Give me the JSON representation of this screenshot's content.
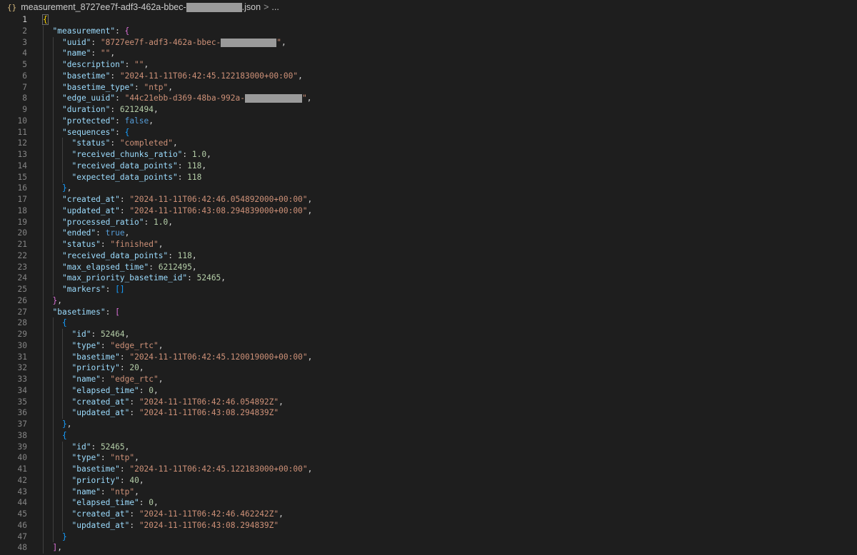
{
  "breadcrumb": {
    "icon": "{}",
    "file_prefix": "measurement_8727ee7f-adf3-462a-bbec-",
    "file_suffix": ".json",
    "separator": ">",
    "ellipsis": "..."
  },
  "colors": {
    "background": "#1e1e1e",
    "key": "#9cdcfe",
    "string": "#ce9178",
    "number": "#b5cea8",
    "keyword": "#569cd6",
    "line_number": "#858585"
  },
  "lines": [
    {
      "n": "1",
      "indent": 0,
      "t": [
        [
          "b1",
          "{"
        ]
      ]
    },
    {
      "n": "2",
      "indent": 1,
      "t": [
        [
          "key",
          "\"measurement\""
        ],
        [
          "punc",
          ": "
        ],
        [
          "b2",
          "{"
        ]
      ]
    },
    {
      "n": "3",
      "indent": 2,
      "t": [
        [
          "key",
          "\"uuid\""
        ],
        [
          "punc",
          ": "
        ],
        [
          "str",
          "\"8727ee7f-adf3-462a-bbec-"
        ],
        [
          "redact",
          ""
        ],
        [
          "str",
          "\""
        ],
        [
          "punc",
          ","
        ]
      ]
    },
    {
      "n": "4",
      "indent": 2,
      "t": [
        [
          "key",
          "\"name\""
        ],
        [
          "punc",
          ": "
        ],
        [
          "str",
          "\"\""
        ],
        [
          "punc",
          ","
        ]
      ]
    },
    {
      "n": "5",
      "indent": 2,
      "t": [
        [
          "key",
          "\"description\""
        ],
        [
          "punc",
          ": "
        ],
        [
          "str",
          "\"\""
        ],
        [
          "punc",
          ","
        ]
      ]
    },
    {
      "n": "6",
      "indent": 2,
      "t": [
        [
          "key",
          "\"basetime\""
        ],
        [
          "punc",
          ": "
        ],
        [
          "str",
          "\"2024-11-11T06:42:45.122183000+00:00\""
        ],
        [
          "punc",
          ","
        ]
      ]
    },
    {
      "n": "7",
      "indent": 2,
      "t": [
        [
          "key",
          "\"basetime_type\""
        ],
        [
          "punc",
          ": "
        ],
        [
          "str",
          "\"ntp\""
        ],
        [
          "punc",
          ","
        ]
      ]
    },
    {
      "n": "8",
      "indent": 2,
      "t": [
        [
          "key",
          "\"edge_uuid\""
        ],
        [
          "punc",
          ": "
        ],
        [
          "str",
          "\"44c21ebb-d369-48ba-992a-"
        ],
        [
          "redact",
          ""
        ],
        [
          "str",
          "\""
        ],
        [
          "punc",
          ","
        ]
      ]
    },
    {
      "n": "9",
      "indent": 2,
      "t": [
        [
          "key",
          "\"duration\""
        ],
        [
          "punc",
          ": "
        ],
        [
          "num",
          "6212494"
        ],
        [
          "punc",
          ","
        ]
      ]
    },
    {
      "n": "10",
      "indent": 2,
      "t": [
        [
          "key",
          "\"protected\""
        ],
        [
          "punc",
          ": "
        ],
        [
          "kw",
          "false"
        ],
        [
          "punc",
          ","
        ]
      ]
    },
    {
      "n": "11",
      "indent": 2,
      "t": [
        [
          "key",
          "\"sequences\""
        ],
        [
          "punc",
          ": "
        ],
        [
          "b3",
          "{"
        ]
      ]
    },
    {
      "n": "12",
      "indent": 3,
      "t": [
        [
          "key",
          "\"status\""
        ],
        [
          "punc",
          ": "
        ],
        [
          "str",
          "\"completed\""
        ],
        [
          "punc",
          ","
        ]
      ]
    },
    {
      "n": "13",
      "indent": 3,
      "t": [
        [
          "key",
          "\"received_chunks_ratio\""
        ],
        [
          "punc",
          ": "
        ],
        [
          "num",
          "1.0"
        ],
        [
          "punc",
          ","
        ]
      ]
    },
    {
      "n": "14",
      "indent": 3,
      "t": [
        [
          "key",
          "\"received_data_points\""
        ],
        [
          "punc",
          ": "
        ],
        [
          "num",
          "118"
        ],
        [
          "punc",
          ","
        ]
      ]
    },
    {
      "n": "15",
      "indent": 3,
      "t": [
        [
          "key",
          "\"expected_data_points\""
        ],
        [
          "punc",
          ": "
        ],
        [
          "num",
          "118"
        ]
      ]
    },
    {
      "n": "16",
      "indent": 2,
      "t": [
        [
          "b3",
          "}"
        ],
        [
          "punc",
          ","
        ]
      ]
    },
    {
      "n": "17",
      "indent": 2,
      "t": [
        [
          "key",
          "\"created_at\""
        ],
        [
          "punc",
          ": "
        ],
        [
          "str",
          "\"2024-11-11T06:42:46.054892000+00:00\""
        ],
        [
          "punc",
          ","
        ]
      ]
    },
    {
      "n": "18",
      "indent": 2,
      "t": [
        [
          "key",
          "\"updated_at\""
        ],
        [
          "punc",
          ": "
        ],
        [
          "str",
          "\"2024-11-11T06:43:08.294839000+00:00\""
        ],
        [
          "punc",
          ","
        ]
      ]
    },
    {
      "n": "19",
      "indent": 2,
      "t": [
        [
          "key",
          "\"processed_ratio\""
        ],
        [
          "punc",
          ": "
        ],
        [
          "num",
          "1.0"
        ],
        [
          "punc",
          ","
        ]
      ]
    },
    {
      "n": "20",
      "indent": 2,
      "t": [
        [
          "key",
          "\"ended\""
        ],
        [
          "punc",
          ": "
        ],
        [
          "kw",
          "true"
        ],
        [
          "punc",
          ","
        ]
      ]
    },
    {
      "n": "21",
      "indent": 2,
      "t": [
        [
          "key",
          "\"status\""
        ],
        [
          "punc",
          ": "
        ],
        [
          "str",
          "\"finished\""
        ],
        [
          "punc",
          ","
        ]
      ]
    },
    {
      "n": "22",
      "indent": 2,
      "t": [
        [
          "key",
          "\"received_data_points\""
        ],
        [
          "punc",
          ": "
        ],
        [
          "num",
          "118"
        ],
        [
          "punc",
          ","
        ]
      ]
    },
    {
      "n": "23",
      "indent": 2,
      "t": [
        [
          "key",
          "\"max_elapsed_time\""
        ],
        [
          "punc",
          ": "
        ],
        [
          "num",
          "6212495"
        ],
        [
          "punc",
          ","
        ]
      ]
    },
    {
      "n": "24",
      "indent": 2,
      "t": [
        [
          "key",
          "\"max_priority_basetime_id\""
        ],
        [
          "punc",
          ": "
        ],
        [
          "num",
          "52465"
        ],
        [
          "punc",
          ","
        ]
      ]
    },
    {
      "n": "25",
      "indent": 2,
      "t": [
        [
          "key",
          "\"markers\""
        ],
        [
          "punc",
          ": "
        ],
        [
          "b3",
          "[]"
        ]
      ]
    },
    {
      "n": "26",
      "indent": 1,
      "t": [
        [
          "b2",
          "}"
        ],
        [
          "punc",
          ","
        ]
      ]
    },
    {
      "n": "27",
      "indent": 1,
      "t": [
        [
          "key",
          "\"basetimes\""
        ],
        [
          "punc",
          ": "
        ],
        [
          "b2",
          "["
        ]
      ]
    },
    {
      "n": "28",
      "indent": 2,
      "t": [
        [
          "b3",
          "{"
        ]
      ]
    },
    {
      "n": "29",
      "indent": 3,
      "t": [
        [
          "key",
          "\"id\""
        ],
        [
          "punc",
          ": "
        ],
        [
          "num",
          "52464"
        ],
        [
          "punc",
          ","
        ]
      ]
    },
    {
      "n": "30",
      "indent": 3,
      "t": [
        [
          "key",
          "\"type\""
        ],
        [
          "punc",
          ": "
        ],
        [
          "str",
          "\"edge_rtc\""
        ],
        [
          "punc",
          ","
        ]
      ]
    },
    {
      "n": "31",
      "indent": 3,
      "t": [
        [
          "key",
          "\"basetime\""
        ],
        [
          "punc",
          ": "
        ],
        [
          "str",
          "\"2024-11-11T06:42:45.120019000+00:00\""
        ],
        [
          "punc",
          ","
        ]
      ]
    },
    {
      "n": "32",
      "indent": 3,
      "t": [
        [
          "key",
          "\"priority\""
        ],
        [
          "punc",
          ": "
        ],
        [
          "num",
          "20"
        ],
        [
          "punc",
          ","
        ]
      ]
    },
    {
      "n": "33",
      "indent": 3,
      "t": [
        [
          "key",
          "\"name\""
        ],
        [
          "punc",
          ": "
        ],
        [
          "str",
          "\"edge_rtc\""
        ],
        [
          "punc",
          ","
        ]
      ]
    },
    {
      "n": "34",
      "indent": 3,
      "t": [
        [
          "key",
          "\"elapsed_time\""
        ],
        [
          "punc",
          ": "
        ],
        [
          "num",
          "0"
        ],
        [
          "punc",
          ","
        ]
      ]
    },
    {
      "n": "35",
      "indent": 3,
      "t": [
        [
          "key",
          "\"created_at\""
        ],
        [
          "punc",
          ": "
        ],
        [
          "str",
          "\"2024-11-11T06:42:46.054892Z\""
        ],
        [
          "punc",
          ","
        ]
      ]
    },
    {
      "n": "36",
      "indent": 3,
      "t": [
        [
          "key",
          "\"updated_at\""
        ],
        [
          "punc",
          ": "
        ],
        [
          "str",
          "\"2024-11-11T06:43:08.294839Z\""
        ]
      ]
    },
    {
      "n": "37",
      "indent": 2,
      "t": [
        [
          "b3",
          "}"
        ],
        [
          "punc",
          ","
        ]
      ]
    },
    {
      "n": "38",
      "indent": 2,
      "t": [
        [
          "b3",
          "{"
        ]
      ]
    },
    {
      "n": "39",
      "indent": 3,
      "t": [
        [
          "key",
          "\"id\""
        ],
        [
          "punc",
          ": "
        ],
        [
          "num",
          "52465"
        ],
        [
          "punc",
          ","
        ]
      ]
    },
    {
      "n": "40",
      "indent": 3,
      "t": [
        [
          "key",
          "\"type\""
        ],
        [
          "punc",
          ": "
        ],
        [
          "str",
          "\"ntp\""
        ],
        [
          "punc",
          ","
        ]
      ]
    },
    {
      "n": "41",
      "indent": 3,
      "t": [
        [
          "key",
          "\"basetime\""
        ],
        [
          "punc",
          ": "
        ],
        [
          "str",
          "\"2024-11-11T06:42:45.122183000+00:00\""
        ],
        [
          "punc",
          ","
        ]
      ]
    },
    {
      "n": "42",
      "indent": 3,
      "t": [
        [
          "key",
          "\"priority\""
        ],
        [
          "punc",
          ": "
        ],
        [
          "num",
          "40"
        ],
        [
          "punc",
          ","
        ]
      ]
    },
    {
      "n": "43",
      "indent": 3,
      "t": [
        [
          "key",
          "\"name\""
        ],
        [
          "punc",
          ": "
        ],
        [
          "str",
          "\"ntp\""
        ],
        [
          "punc",
          ","
        ]
      ]
    },
    {
      "n": "44",
      "indent": 3,
      "t": [
        [
          "key",
          "\"elapsed_time\""
        ],
        [
          "punc",
          ": "
        ],
        [
          "num",
          "0"
        ],
        [
          "punc",
          ","
        ]
      ]
    },
    {
      "n": "45",
      "indent": 3,
      "t": [
        [
          "key",
          "\"created_at\""
        ],
        [
          "punc",
          ": "
        ],
        [
          "str",
          "\"2024-11-11T06:42:46.462242Z\""
        ],
        [
          "punc",
          ","
        ]
      ]
    },
    {
      "n": "46",
      "indent": 3,
      "t": [
        [
          "key",
          "\"updated_at\""
        ],
        [
          "punc",
          ": "
        ],
        [
          "str",
          "\"2024-11-11T06:43:08.294839Z\""
        ]
      ]
    },
    {
      "n": "47",
      "indent": 2,
      "t": [
        [
          "b3",
          "}"
        ]
      ]
    },
    {
      "n": "48",
      "indent": 1,
      "t": [
        [
          "b2",
          "]"
        ],
        [
          "punc",
          ","
        ]
      ]
    }
  ]
}
